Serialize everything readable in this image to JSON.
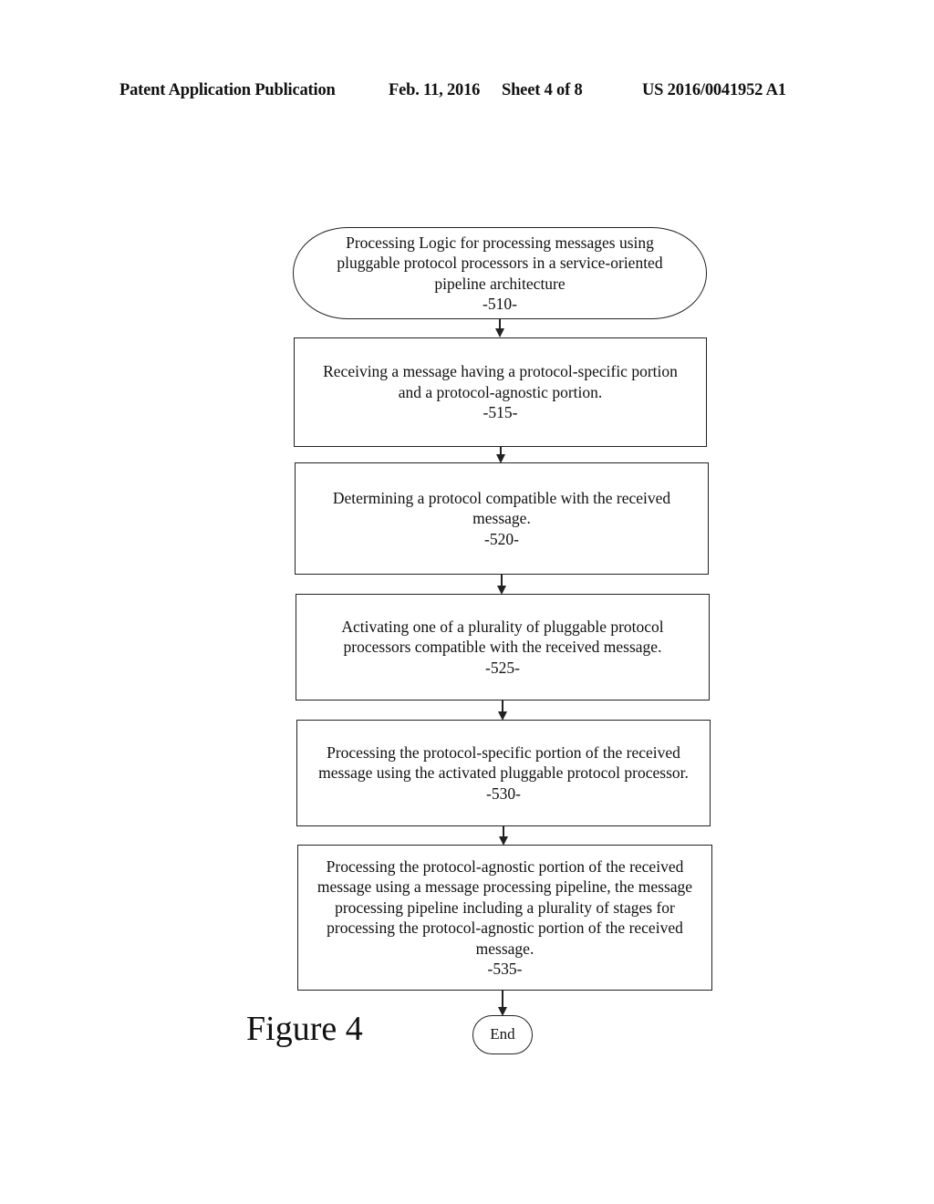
{
  "header": {
    "publication": "Patent Application Publication",
    "date": "Feb. 11, 2016",
    "sheet": "Sheet 4 of 8",
    "number": "US 2016/0041952 A1"
  },
  "flowchart": {
    "start": {
      "text": "Processing Logic for processing messages using\npluggable protocol processors in a service-oriented\npipeline architecture",
      "ref": "-510-"
    },
    "steps": [
      {
        "text": "Receiving a message having a protocol-specific portion\nand a protocol-agnostic portion.",
        "ref": "-515-"
      },
      {
        "text": "Determining a protocol compatible with the received\nmessage.",
        "ref": "-520-"
      },
      {
        "text": "Activating one of a plurality of pluggable protocol\nprocessors compatible with the received message.",
        "ref": "-525-"
      },
      {
        "text": "Processing the protocol-specific portion of the received\nmessage using the activated pluggable protocol processor.",
        "ref": "-530-"
      },
      {
        "text": "Processing the protocol-agnostic portion of the received\nmessage using a message processing pipeline, the message\nprocessing pipeline including a plurality of stages for\nprocessing the protocol-agnostic portion of the received\nmessage.",
        "ref": "-535-"
      }
    ],
    "end": {
      "text": "End"
    }
  },
  "figure_label": "Figure 4"
}
